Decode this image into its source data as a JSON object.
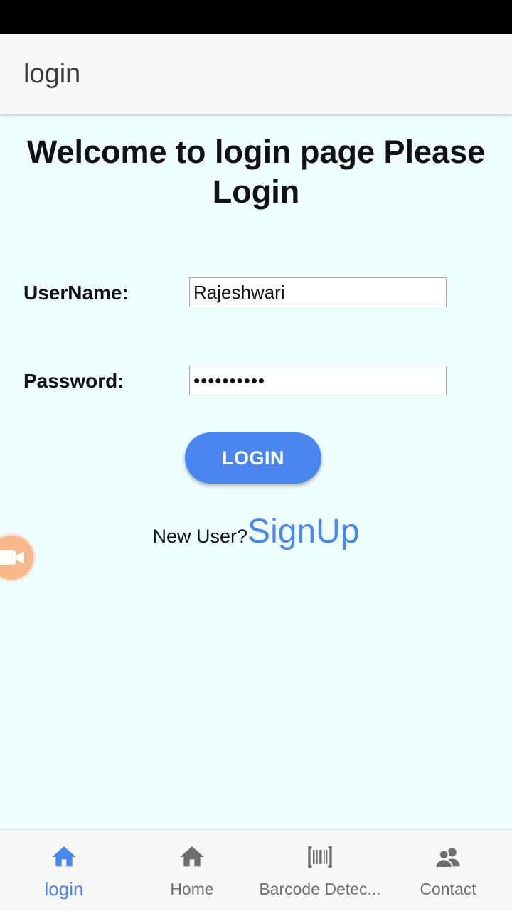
{
  "app_bar": {
    "title": "login"
  },
  "heading": "Welcome to login page Please Login",
  "form": {
    "username_label": "UserName:",
    "username_value": "Rajeshwari",
    "password_label": "Password:",
    "password_value": "••••••••••",
    "login_button": "LOGIN"
  },
  "signup": {
    "prompt": "New User?",
    "link": "SignUp"
  },
  "bottom_nav": {
    "items": [
      {
        "label": "login",
        "icon": "home-icon",
        "active": true
      },
      {
        "label": "Home",
        "icon": "home-icon",
        "active": false
      },
      {
        "label": "Barcode Detec...",
        "icon": "barcode-icon",
        "active": false
      },
      {
        "label": "Contact",
        "icon": "contacts-icon",
        "active": false
      }
    ]
  },
  "colors": {
    "accent": "#4a86ef",
    "background": "#effeff",
    "app_bar": "#f8f8f8",
    "floating_button": "#f7b98b"
  }
}
